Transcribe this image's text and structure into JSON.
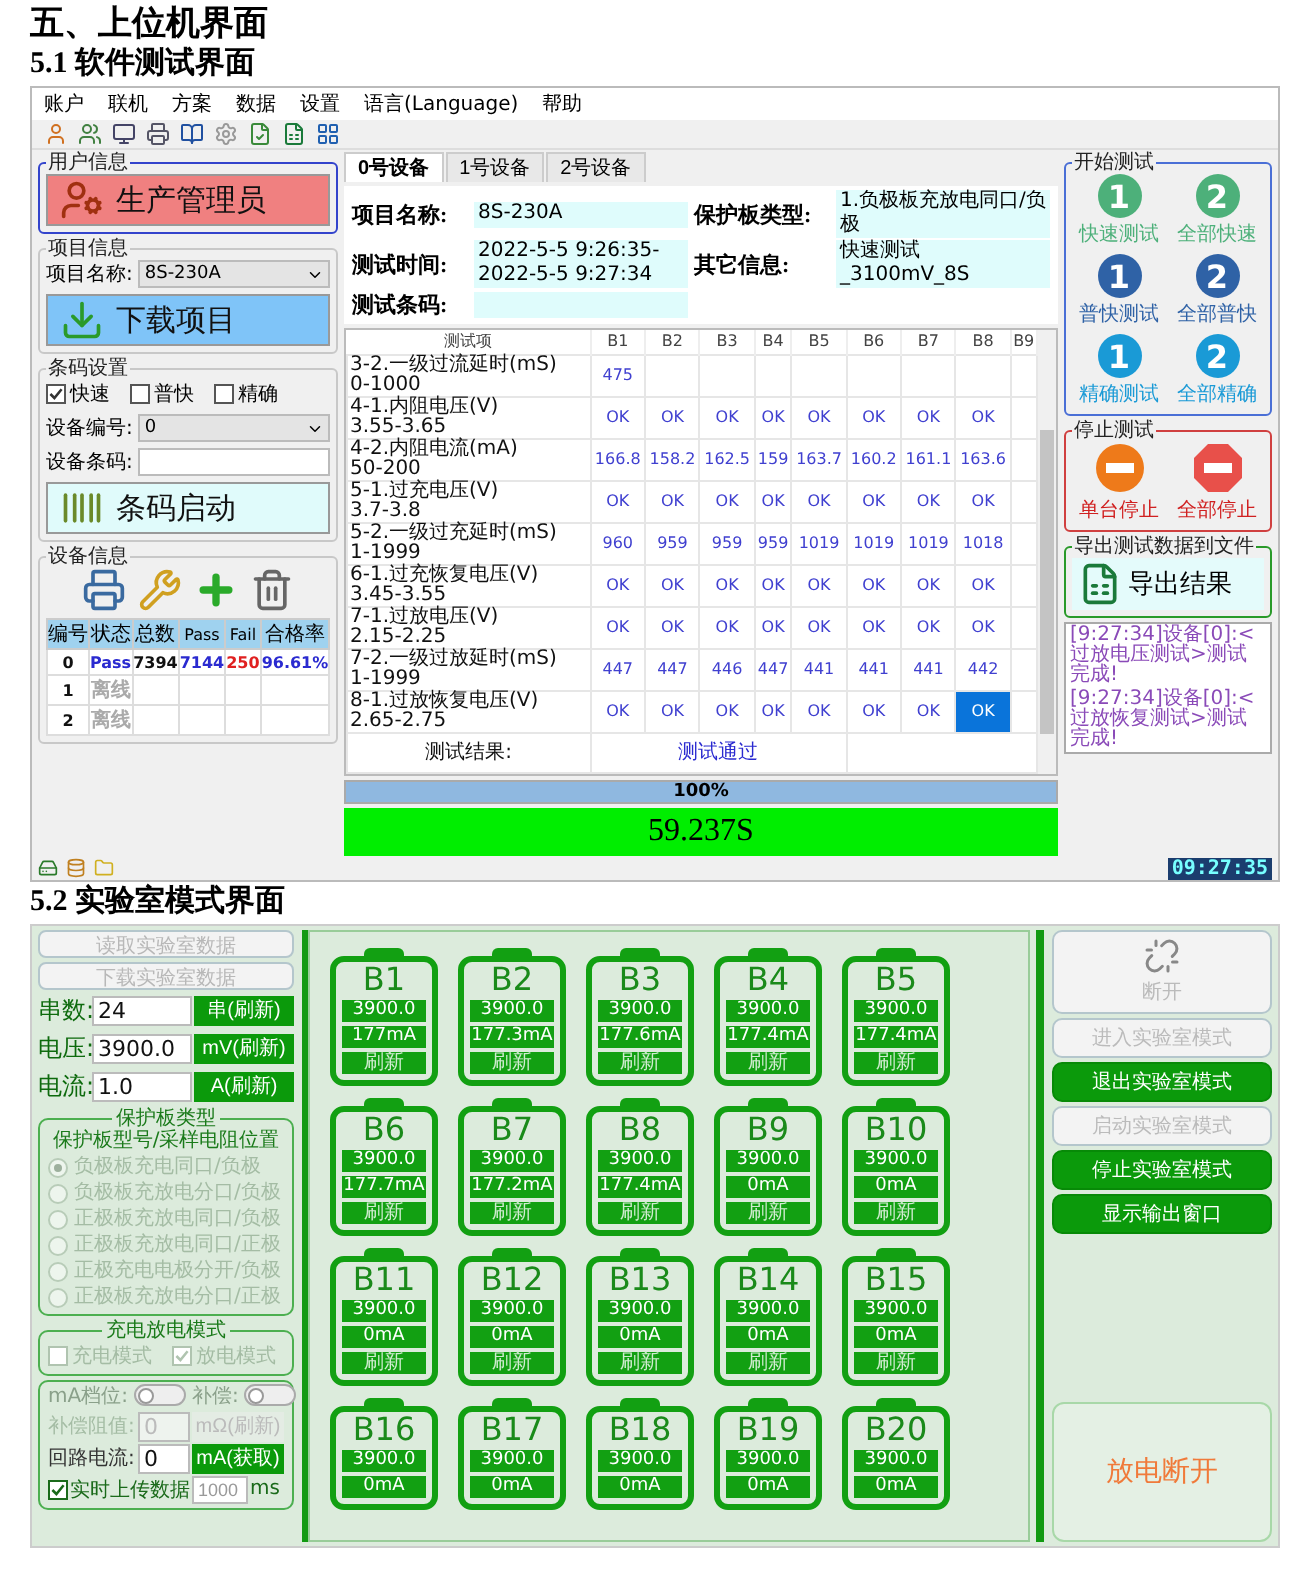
{
  "document": {
    "title": "五、上位机界面",
    "section_1": "5.1 软件测试界面",
    "section_2": "5.2 实验室模式界面"
  },
  "test_app": {
    "menu": [
      "账户",
      "联机",
      "方案",
      "数据",
      "设置",
      "语言(Language)",
      "帮助"
    ],
    "user_group": {
      "legend": "用户信息",
      "button": "生产管理员"
    },
    "project_group": {
      "legend": "项目信息",
      "label": "项目名称:",
      "value": "8S-230A",
      "button": "下载项目"
    },
    "barcode_group": {
      "legend": "条码设置",
      "options": [
        {
          "label": "快速",
          "checked": true
        },
        {
          "label": "普快",
          "checked": false
        },
        {
          "label": "精确",
          "checked": false
        }
      ],
      "device_no": {
        "label": "设备编号:",
        "value": "0"
      },
      "device_barcode": {
        "label": "设备条码:"
      },
      "button": "条码启动"
    },
    "device_group": {
      "legend": "设备信息",
      "columns": [
        "编号",
        "状态",
        "总数",
        "Pass",
        "Fail",
        "合格率"
      ],
      "rows": [
        {
          "kind": "online",
          "cells": [
            "0",
            "Pass",
            "7394",
            "7144",
            "250",
            "96.61%"
          ]
        },
        {
          "kind": "offline",
          "cells": [
            "1",
            "离线"
          ]
        },
        {
          "kind": "offline",
          "cells": [
            "2",
            "离线"
          ]
        }
      ]
    },
    "tabs": [
      {
        "label": "0号设备",
        "selected": true
      },
      {
        "label": "1号设备",
        "selected": false
      },
      {
        "label": "2号设备",
        "selected": false
      }
    ],
    "info_rows": [
      {
        "fields": [
          {
            "label": "项目名称:",
            "value": "8S-230A"
          },
          {
            "label": "保护板类型:",
            "value": "1.负极板充放电同口/负极"
          }
        ]
      },
      {
        "fields": [
          {
            "label": "测试时间:",
            "value": "2022-5-5 9:26:35-2022-5-5 9:27:34"
          },
          {
            "label": "其它信息:",
            "value": "快速测试_3100mV_8S"
          }
        ]
      },
      {
        "fields": [
          {
            "label": "测试条码:"
          }
        ]
      }
    ],
    "table": {
      "corner": "测试项",
      "columns": [
        "B1",
        "B2",
        "B3",
        "B4",
        "B5",
        "B6",
        "B7",
        "B8",
        "B9"
      ],
      "rows": [
        {
          "item": "3-2.一级过流延时(mS)",
          "range": "0-1000",
          "cells": [
            {
              "text": "475",
              "selected": false
            }
          ]
        },
        {
          "item": "4-1.内阻电压(V)",
          "range": "3.55-3.65",
          "cells": [
            {
              "text": "OK",
              "selected": false
            },
            {
              "text": "OK",
              "selected": false
            },
            {
              "text": "OK",
              "selected": false
            },
            {
              "text": "OK",
              "selected": false
            },
            {
              "text": "OK",
              "selected": false
            },
            {
              "text": "OK",
              "selected": false
            },
            {
              "text": "OK",
              "selected": false
            },
            {
              "text": "OK",
              "selected": false
            }
          ]
        },
        {
          "item": "4-2.内阻电流(mA)",
          "range": "50-200",
          "cells": [
            {
              "text": "166.8",
              "selected": false
            },
            {
              "text": "158.2",
              "selected": false
            },
            {
              "text": "162.5",
              "selected": false
            },
            {
              "text": "159",
              "selected": false
            },
            {
              "text": "163.7",
              "selected": false
            },
            {
              "text": "160.2",
              "selected": false
            },
            {
              "text": "161.1",
              "selected": false
            },
            {
              "text": "163.6",
              "selected": false
            }
          ]
        },
        {
          "item": "5-1.过充电压(V)",
          "range": "3.7-3.8",
          "cells": [
            {
              "text": "OK",
              "selected": false
            },
            {
              "text": "OK",
              "selected": false
            },
            {
              "text": "OK",
              "selected": false
            },
            {
              "text": "OK",
              "selected": false
            },
            {
              "text": "OK",
              "selected": false
            },
            {
              "text": "OK",
              "selected": false
            },
            {
              "text": "OK",
              "selected": false
            },
            {
              "text": "OK",
              "selected": false
            }
          ]
        },
        {
          "item": "5-2.一级过充延时(mS)",
          "range": "1-1999",
          "cells": [
            {
              "text": "960",
              "selected": false
            },
            {
              "text": "959",
              "selected": false
            },
            {
              "text": "959",
              "selected": false
            },
            {
              "text": "959",
              "selected": false
            },
            {
              "text": "1019",
              "selected": false
            },
            {
              "text": "1019",
              "selected": false
            },
            {
              "text": "1019",
              "selected": false
            },
            {
              "text": "1018",
              "selected": false
            }
          ]
        },
        {
          "item": "6-1.过充恢复电压(V)",
          "range": "3.45-3.55",
          "cells": [
            {
              "text": "OK",
              "selected": false
            },
            {
              "text": "OK",
              "selected": false
            },
            {
              "text": "OK",
              "selected": false
            },
            {
              "text": "OK",
              "selected": false
            },
            {
              "text": "OK",
              "selected": false
            },
            {
              "text": "OK",
              "selected": false
            },
            {
              "text": "OK",
              "selected": false
            },
            {
              "text": "OK",
              "selected": false
            }
          ]
        },
        {
          "item": "7-1.过放电压(V)",
          "range": "2.15-2.25",
          "cells": [
            {
              "text": "OK",
              "selected": false
            },
            {
              "text": "OK",
              "selected": false
            },
            {
              "text": "OK",
              "selected": false
            },
            {
              "text": "OK",
              "selected": false
            },
            {
              "text": "OK",
              "selected": false
            },
            {
              "text": "OK",
              "selected": false
            },
            {
              "text": "OK",
              "selected": false
            },
            {
              "text": "OK",
              "selected": false
            }
          ]
        },
        {
          "item": "7-2.一级过放延时(mS)",
          "range": "1-1999",
          "cells": [
            {
              "text": "447",
              "selected": false
            },
            {
              "text": "447",
              "selected": false
            },
            {
              "text": "446",
              "selected": false
            },
            {
              "text": "447",
              "selected": false
            },
            {
              "text": "441",
              "selected": false
            },
            {
              "text": "441",
              "selected": false
            },
            {
              "text": "441",
              "selected": false
            },
            {
              "text": "442",
              "selected": false
            }
          ]
        },
        {
          "item": "8-1.过放恢复电压(V)",
          "range": "2.65-2.75",
          "cells": [
            {
              "text": "OK",
              "selected": false
            },
            {
              "text": "OK",
              "selected": false
            },
            {
              "text": "OK",
              "selected": false
            },
            {
              "text": "OK",
              "selected": false
            },
            {
              "text": "OK",
              "selected": false
            },
            {
              "text": "OK",
              "selected": false
            },
            {
              "text": "OK",
              "selected": false
            },
            {
              "text": "OK",
              "selected": true
            }
          ]
        }
      ],
      "result_label": "测试结果:",
      "result_value": "测试通过"
    },
    "progress": {
      "level": 1,
      "reading": "100%"
    },
    "elapsed": "59.237S",
    "start_group": {
      "legend": "开始测试",
      "buttons": [
        {
          "number": "1",
          "label": "快速测试",
          "color": "#4db07a"
        },
        {
          "number": "2",
          "label": "全部快速",
          "color": "#4db07a"
        },
        {
          "number": "1",
          "label": "普快测试",
          "color": "#2f62a6"
        },
        {
          "number": "2",
          "label": "全部普快",
          "color": "#2f62a6"
        },
        {
          "number": "1",
          "label": "精确测试",
          "color": "#1a9ad6"
        },
        {
          "number": "2",
          "label": "全部精确",
          "color": "#1a9ad6"
        }
      ]
    },
    "stop_group": {
      "legend": "停止测试",
      "buttons": [
        {
          "label": "单台停止",
          "kind": "circle"
        },
        {
          "label": "全部停止",
          "kind": "octagon"
        }
      ]
    },
    "export_group": {
      "legend": "导出测试数据到文件",
      "button": "导出结果"
    },
    "log": [
      "[9:27:34]设备[0]:<过放电压测试>测试完成!",
      "[9:27:34]设备[0]:<过放恢复测试>测试完成!"
    ],
    "clock": "09:27:35"
  },
  "lab_app": {
    "buttons": [
      {
        "label": "读取实验室数据",
        "disabled": true
      },
      {
        "label": "下载实验室数据",
        "disabled": true
      }
    ],
    "params": [
      {
        "label": "串数:",
        "value": "24",
        "button": "串(刷新)"
      },
      {
        "label": "电压:",
        "value": "3900.0",
        "button": "mV(刷新)"
      },
      {
        "label": "电流:",
        "value": "1.0",
        "button": "A(刷新)"
      }
    ],
    "board_group": {
      "legend": "保护板类型",
      "subtitle": "保护板型号/采样电阻位置",
      "options": [
        {
          "label": "负极板充电同口/负极",
          "selected": true
        },
        {
          "label": "负极板充放电分口/负极",
          "selected": false
        },
        {
          "label": "正极板充放电同口/负极",
          "selected": false
        },
        {
          "label": "正极板充放电同口/正极",
          "selected": false
        },
        {
          "label": "正极充电电极分开/负极",
          "selected": false
        },
        {
          "label": "正极板充放电分口/正极",
          "selected": false
        }
      ]
    },
    "mode_group": {
      "legend": "充电放电模式",
      "options": [
        {
          "label": "充电模式",
          "checked": false
        },
        {
          "label": "放电模式",
          "checked": true
        }
      ]
    },
    "toggles": [
      {
        "label": "mA档位:",
        "on": false
      },
      {
        "label": "补偿:",
        "on": false
      }
    ],
    "fields": [
      {
        "label": "补偿阻值:",
        "value": "0",
        "button": "mΩ(刷新)",
        "disabled": true
      },
      {
        "label": "回路电流:",
        "value": "0",
        "button": "mA(获取)",
        "disabled": false
      }
    ],
    "upload": {
      "label": "实时上传数据",
      "checked": true,
      "placeholder": "1000",
      "unit": "ms"
    },
    "cells": [
      {
        "name": "B1",
        "voltage": "3900.0",
        "current": "177mA",
        "button": "刷新"
      },
      {
        "name": "B2",
        "voltage": "3900.0",
        "current": "177.3mA",
        "button": "刷新"
      },
      {
        "name": "B3",
        "voltage": "3900.0",
        "current": "177.6mA",
        "button": "刷新"
      },
      {
        "name": "B4",
        "voltage": "3900.0",
        "current": "177.4mA",
        "button": "刷新"
      },
      {
        "name": "B5",
        "voltage": "3900.0",
        "current": "177.4mA",
        "button": "刷新"
      },
      {
        "name": "B6",
        "voltage": "3900.0",
        "current": "177.7mA",
        "button": "刷新"
      },
      {
        "name": "B7",
        "voltage": "3900.0",
        "current": "177.2mA",
        "button": "刷新"
      },
      {
        "name": "B8",
        "voltage": "3900.0",
        "current": "177.4mA",
        "button": "刷新"
      },
      {
        "name": "B9",
        "voltage": "3900.0",
        "current": "0mA",
        "button": "刷新"
      },
      {
        "name": "B10",
        "voltage": "3900.0",
        "current": "0mA",
        "button": "刷新"
      },
      {
        "name": "B11",
        "voltage": "3900.0",
        "current": "0mA",
        "button": "刷新"
      },
      {
        "name": "B12",
        "voltage": "3900.0",
        "current": "0mA",
        "button": "刷新"
      },
      {
        "name": "B13",
        "voltage": "3900.0",
        "current": "0mA",
        "button": "刷新"
      },
      {
        "name": "B14",
        "voltage": "3900.0",
        "current": "0mA",
        "button": "刷新"
      },
      {
        "name": "B15",
        "voltage": "3900.0",
        "current": "0mA",
        "button": "刷新"
      },
      {
        "name": "B16",
        "voltage": "3900.0",
        "current": "0mA"
      },
      {
        "name": "B17",
        "voltage": "3900.0",
        "current": "0mA"
      },
      {
        "name": "B18",
        "voltage": "3900.0",
        "current": "0mA"
      },
      {
        "name": "B19",
        "voltage": "3900.0",
        "current": "0mA"
      },
      {
        "name": "B20",
        "voltage": "3900.0",
        "current": "0mA"
      }
    ],
    "actions": [
      {
        "label": "断开",
        "kind": "icon",
        "disabled": true
      },
      {
        "label": "进入实验室模式",
        "kind": "plain",
        "disabled": true
      },
      {
        "label": "退出实验室模式",
        "kind": "plain",
        "disabled": false
      },
      {
        "label": "启动实验室模式",
        "kind": "plain",
        "disabled": true
      },
      {
        "label": "停止实验室模式",
        "kind": "plain",
        "disabled": false
      },
      {
        "label": "显示输出窗口",
        "kind": "plain",
        "disabled": false
      }
    ],
    "discharge": "放电断开"
  }
}
